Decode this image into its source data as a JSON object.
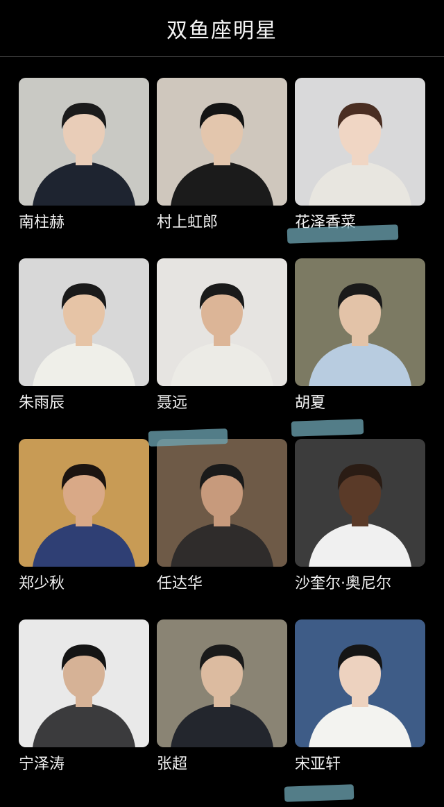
{
  "header": {
    "title": "双鱼座明星"
  },
  "stars": [
    {
      "name": "南柱赫",
      "bg": "#c9c9c4",
      "skin": "#e9cdb8",
      "hair": "#1b1b1b",
      "cloth": "#1e2430"
    },
    {
      "name": "村上虹郎",
      "bg": "#cfc7bd",
      "skin": "#e3c6ad",
      "hair": "#141414",
      "cloth": "#1b1b1b"
    },
    {
      "name": "花泽香菜",
      "bg": "#d9d9da",
      "skin": "#f0d6c4",
      "hair": "#4a2e22",
      "cloth": "#e8e6e0"
    },
    {
      "name": "朱雨辰",
      "bg": "#d8d8d8",
      "skin": "#e6c4a6",
      "hair": "#1a1a1a",
      "cloth": "#efefe9"
    },
    {
      "name": "聂远",
      "bg": "#e6e4e1",
      "skin": "#dcb597",
      "hair": "#1a1a1a",
      "cloth": "#ecebe6"
    },
    {
      "name": "胡夏",
      "bg": "#7c7a63",
      "skin": "#e3c3a8",
      "hair": "#1a1a1a",
      "cloth": "#b8cce0"
    },
    {
      "name": "郑少秋",
      "bg": "#c89b55",
      "skin": "#d9a987",
      "hair": "#1c1410",
      "cloth": "#2f3f74"
    },
    {
      "name": "任达华",
      "bg": "#6e5a47",
      "skin": "#c79a7c",
      "hair": "#1a1a1a",
      "cloth": "#2f2c2b"
    },
    {
      "name": "沙奎尔·奥尼尔",
      "bg": "#3c3c3c",
      "skin": "#5a3a28",
      "hair": "#2a1c14",
      "cloth": "#f0f0f0"
    },
    {
      "name": "宁泽涛",
      "bg": "#e9e9e9",
      "skin": "#d6b296",
      "hair": "#141414",
      "cloth": "#3b3b3d"
    },
    {
      "name": "张超",
      "bg": "#8a8474",
      "skin": "#dcbba0",
      "hair": "#1a1a1a",
      "cloth": "#23262d"
    },
    {
      "name": "宋亚轩",
      "bg": "#3e5c87",
      "skin": "#edd2bf",
      "hair": "#151515",
      "cloth": "#f3f3f0"
    }
  ]
}
